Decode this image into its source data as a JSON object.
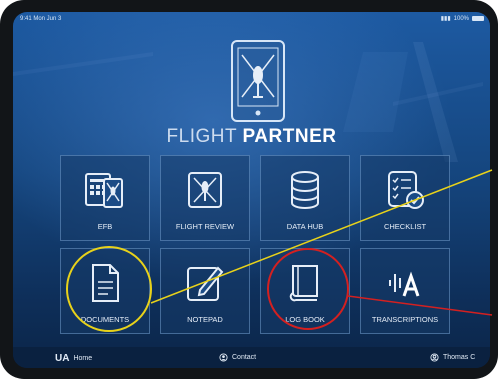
{
  "status_bar": {
    "time": "9:41 Mon Jun 3",
    "battery": "100%"
  },
  "app": {
    "title_light": "FLIGHT",
    "title_bold": "PARTNER"
  },
  "tiles": [
    {
      "label": "EFB",
      "icon": "efb-tablet-icon"
    },
    {
      "label": "FLIGHT REVIEW",
      "icon": "flight-review-icon"
    },
    {
      "label": "DATA HUB",
      "icon": "database-icon"
    },
    {
      "label": "CHECKLIST",
      "icon": "checklist-icon"
    },
    {
      "label": "DOCUMENTS",
      "icon": "document-icon"
    },
    {
      "label": "NOTEPAD",
      "icon": "notepad-icon"
    },
    {
      "label": "LOG BOOK",
      "icon": "book-icon"
    },
    {
      "label": "TRANSCRIPTIONS",
      "icon": "transcription-icon"
    }
  ],
  "bottom_bar": {
    "logo": "UA",
    "home_label": "Home",
    "contact_label": "Contact",
    "user_label": "Thomas C"
  },
  "annotation_colors": {
    "documents_circle": "#e8d21a",
    "logbook_circle": "#d42020"
  }
}
